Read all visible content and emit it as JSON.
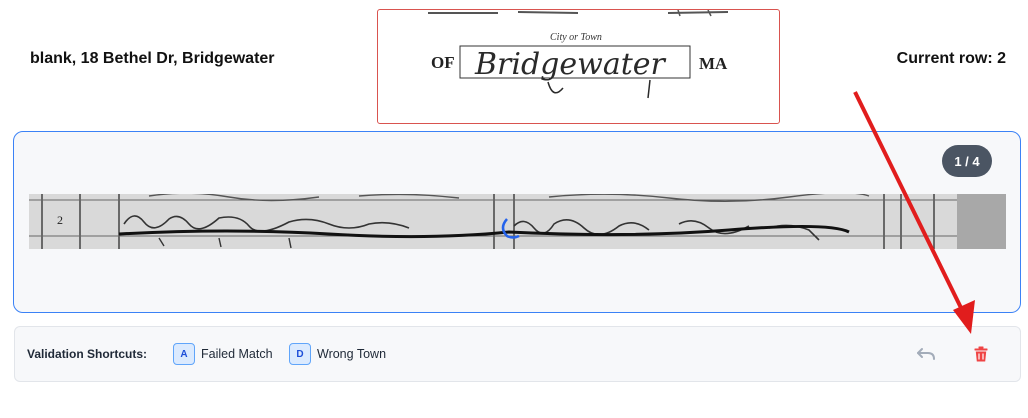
{
  "header": {
    "record_text": "blank, 18 Bethel Dr, Bridgewater",
    "current_row": "Current row: 2"
  },
  "town_crop": {
    "caption": "City or Town",
    "prefix": "OF",
    "handwritten": "Bridgewater",
    "suffix": "MA"
  },
  "row_strip": {
    "row_number": "2"
  },
  "pager": {
    "label": "1 / 4"
  },
  "shortcuts": {
    "label": "Validation Shortcuts:",
    "items": [
      {
        "key": "A",
        "label": "Failed Match"
      },
      {
        "key": "D",
        "label": "Wrong Town"
      }
    ]
  },
  "actions": {
    "undo_icon": "undo-icon",
    "delete_icon": "trash-icon"
  },
  "colors": {
    "accent": "#3b82f6",
    "danger": "#ef4444",
    "arrow": "#e11d1d",
    "crop_border": "#d9534f"
  }
}
